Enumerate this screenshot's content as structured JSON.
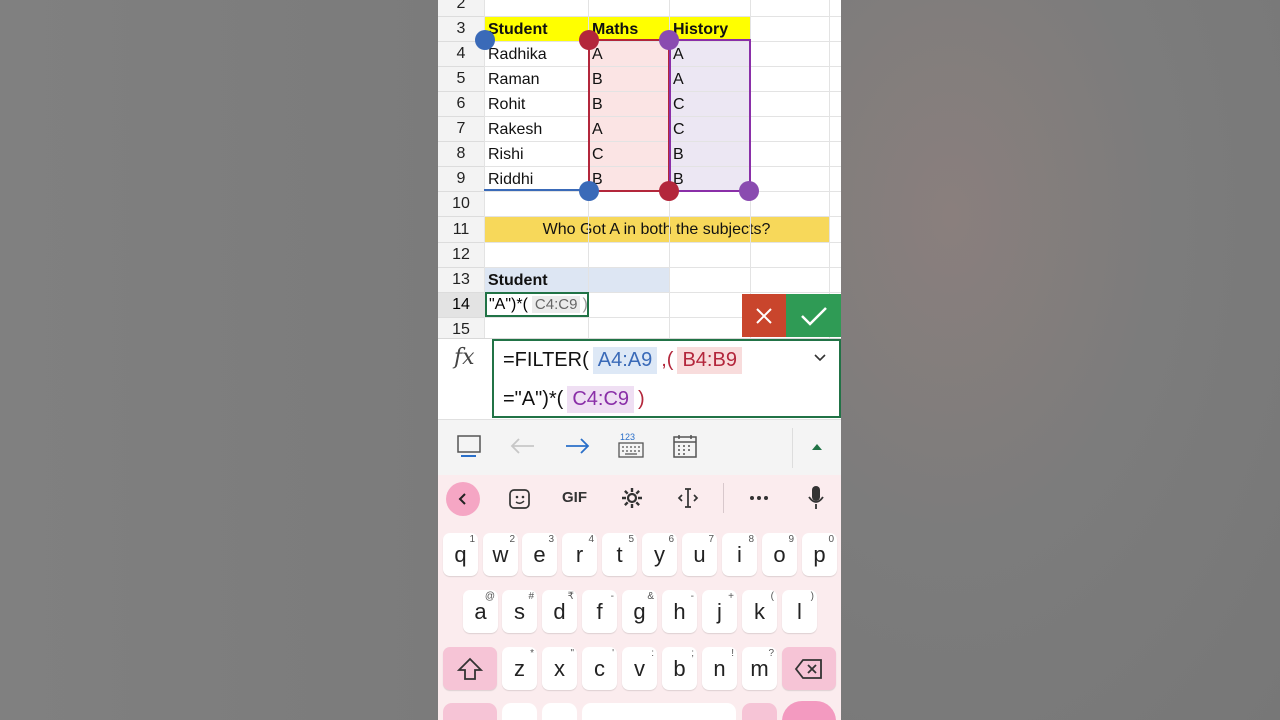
{
  "row_numbers": [
    "2",
    "3",
    "4",
    "5",
    "6",
    "7",
    "8",
    "9",
    "10",
    "11",
    "12",
    "13",
    "14",
    "15"
  ],
  "table": {
    "headers": [
      "Student",
      "Maths",
      "History"
    ],
    "rows": [
      [
        "Radhika",
        "A",
        "A"
      ],
      [
        "Raman",
        "B",
        "A"
      ],
      [
        "Rohit",
        "B",
        "C"
      ],
      [
        "Rakesh",
        "A",
        "C"
      ],
      [
        "Rishi",
        "C",
        "B"
      ],
      [
        "Riddhi",
        "B",
        "B"
      ]
    ]
  },
  "question": "Who Got A in both the subjects?",
  "result_header": "Student",
  "edit_cell": {
    "text": "\"A\")*(",
    "range": "C4:C9",
    "close": ")"
  },
  "formula": {
    "fx": "fx",
    "prefix": "=FILTER(",
    "range1": "A4:A9",
    "sep": ",(",
    "range2": "B4:B9",
    "line2_prefix": "=\"A\")*(",
    "range3": "C4:C9",
    "close": ")"
  },
  "keyboard": {
    "gif": "GIF",
    "rows": [
      [
        [
          "q",
          "1"
        ],
        [
          "w",
          "2"
        ],
        [
          "e",
          "3"
        ],
        [
          "r",
          "4"
        ],
        [
          "t",
          "5"
        ],
        [
          "y",
          "6"
        ],
        [
          "u",
          "7"
        ],
        [
          "i",
          "8"
        ],
        [
          "o",
          "9"
        ],
        [
          "p",
          "0"
        ]
      ],
      [
        [
          "a",
          "@"
        ],
        [
          "s",
          "#"
        ],
        [
          "d",
          "₹"
        ],
        [
          "f",
          "-"
        ],
        [
          "g",
          "&"
        ],
        [
          "h",
          "-"
        ],
        [
          "j",
          "+"
        ],
        [
          "k",
          "("
        ],
        [
          "l",
          ")"
        ]
      ],
      [
        [
          "z",
          "*"
        ],
        [
          "x",
          "\""
        ],
        [
          "c",
          "'"
        ],
        [
          "v",
          ":"
        ],
        [
          "b",
          ";"
        ],
        [
          "n",
          "!"
        ],
        [
          "m",
          "?"
        ]
      ]
    ]
  },
  "toolbar": {
    "keyboard_icon_text": "123"
  },
  "colors": {
    "excel_green": "#217346",
    "range_blue": "#3a6ab8",
    "range_red": "#b3263b",
    "range_purple": "#8a2fa8"
  }
}
